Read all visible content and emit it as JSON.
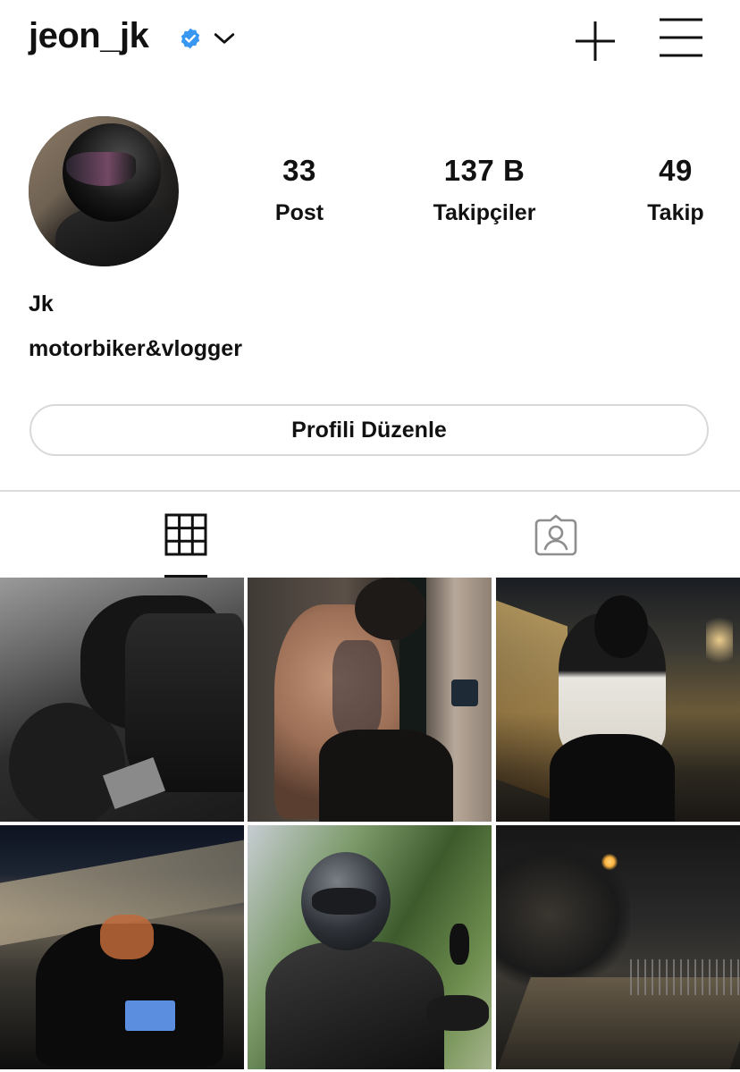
{
  "header": {
    "username": "jeon_jk",
    "verified_icon": "verified-badge-icon",
    "dropdown_icon": "chevron-down-icon",
    "new_post_icon": "plus-icon",
    "menu_icon": "hamburger-menu-icon"
  },
  "profile": {
    "avatar_icon": "profile-avatar",
    "stats": [
      {
        "value": "33",
        "label": "Post"
      },
      {
        "value": "137 B",
        "label": "Takipçiler"
      },
      {
        "value": "49",
        "label": "Takip"
      }
    ],
    "name": "Jk",
    "bio": "motorbiker&vlogger",
    "edit_button": "Profili Düzenle"
  },
  "tabs": [
    {
      "icon": "grid-icon",
      "active": true
    },
    {
      "icon": "tagged-person-icon",
      "active": false
    }
  ],
  "posts_count_shown": 6,
  "colors": {
    "verified": "#3897f0",
    "text": "#111111",
    "border": "#d9d9d9"
  }
}
